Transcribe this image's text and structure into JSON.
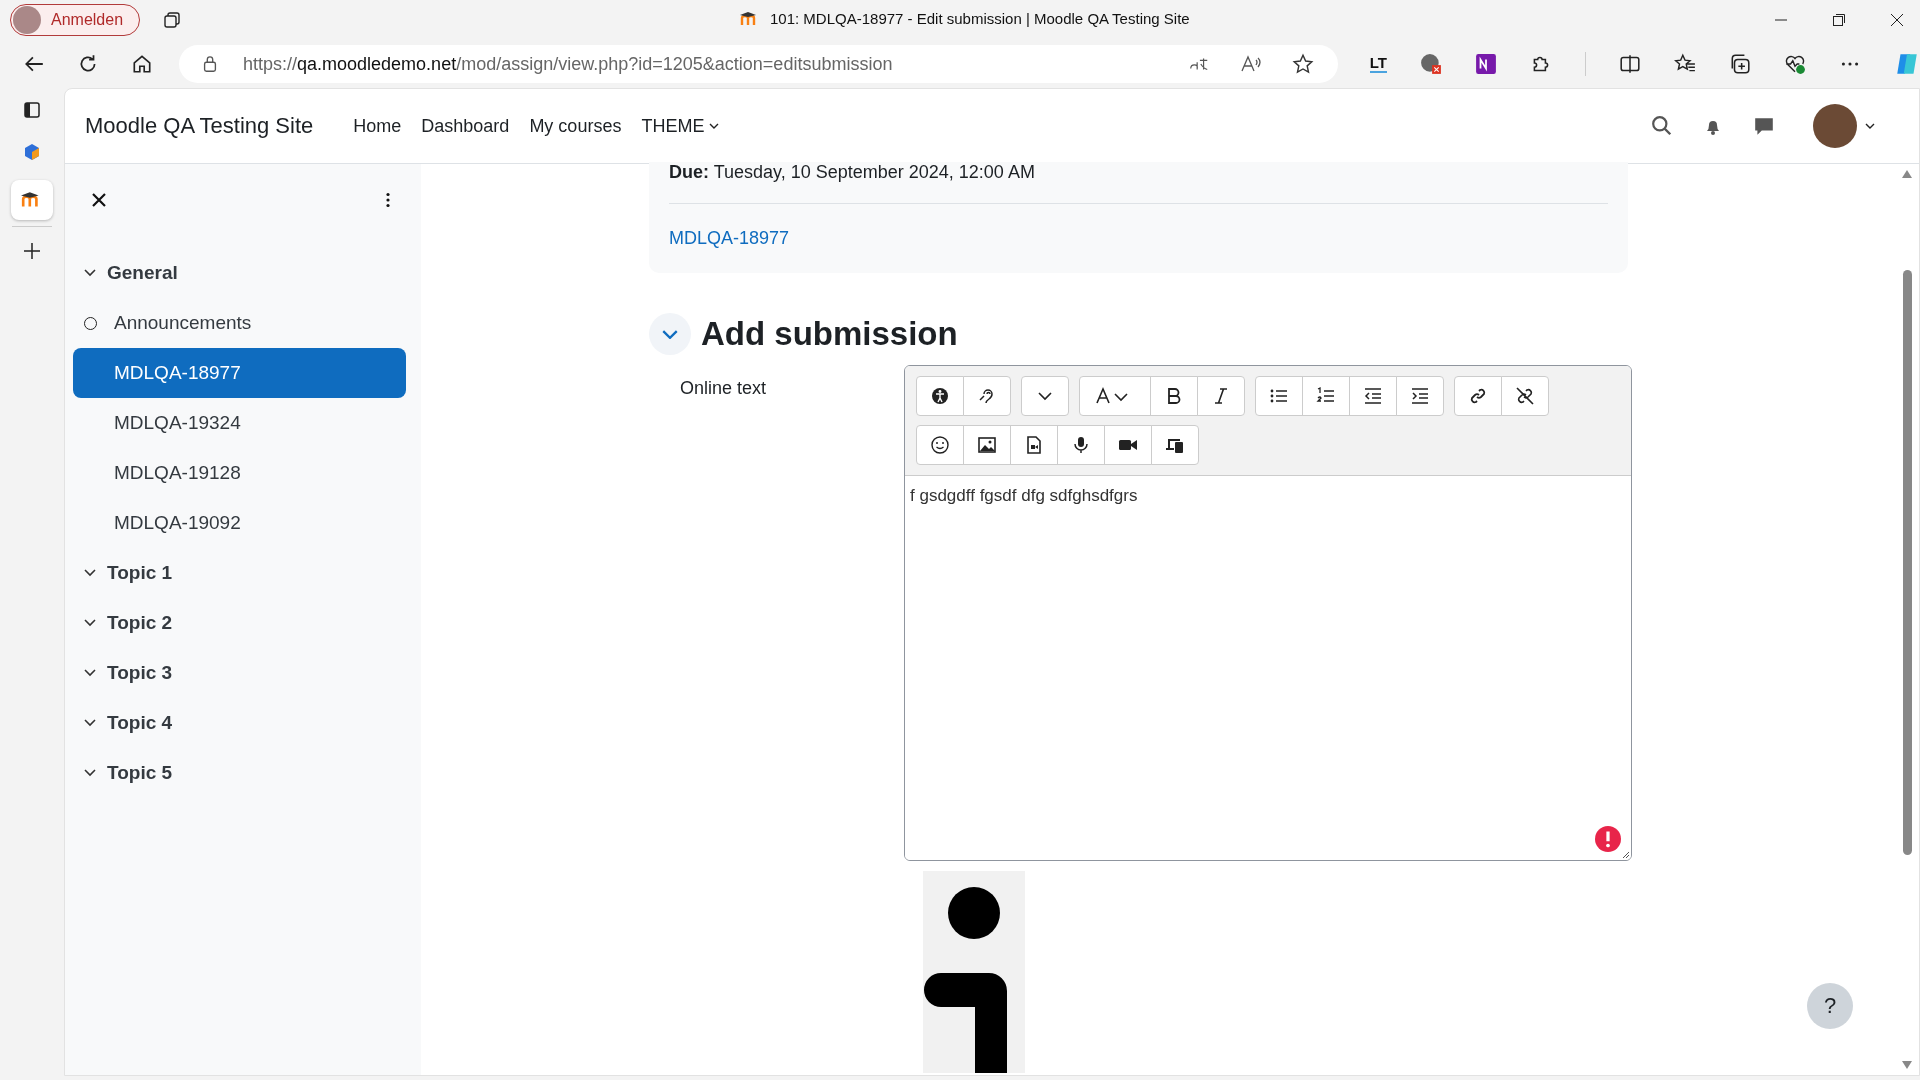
{
  "browser": {
    "profile_button": "Anmelden",
    "tab_title": "101: MDLQA-18977 - Edit submission | Moodle QA Testing Site",
    "url_scheme": "https://",
    "url_host": "qa.moodledemo.net",
    "url_path": "/mod/assign/view.php?id=1205&action=editsubmission",
    "extension_label": "LT"
  },
  "navbar": {
    "site_name": "Moodle QA Testing Site",
    "links": [
      {
        "label": "Home",
        "dropdown": false
      },
      {
        "label": "Dashboard",
        "dropdown": false
      },
      {
        "label": "My courses",
        "dropdown": false
      },
      {
        "label": "THEME",
        "dropdown": true
      }
    ]
  },
  "course_index": {
    "items": [
      {
        "kind": "section",
        "label": "General",
        "expanded": true,
        "selected": false,
        "children": [
          {
            "kind": "forum",
            "label": "Announcements",
            "selected": false
          },
          {
            "kind": "assign",
            "label": "MDLQA-18977",
            "selected": true
          },
          {
            "kind": "assign",
            "label": "MDLQA-19324",
            "selected": false
          },
          {
            "kind": "assign",
            "label": "MDLQA-19128",
            "selected": false
          },
          {
            "kind": "assign",
            "label": "MDLQA-19092",
            "selected": false
          }
        ]
      },
      {
        "kind": "section",
        "label": "Topic 1",
        "expanded": true,
        "selected": false
      },
      {
        "kind": "section",
        "label": "Topic 2",
        "expanded": true,
        "selected": false
      },
      {
        "kind": "section",
        "label": "Topic 3",
        "expanded": true,
        "selected": false
      },
      {
        "kind": "section",
        "label": "Topic 4",
        "expanded": true,
        "selected": false
      },
      {
        "kind": "section",
        "label": "Topic 5",
        "expanded": true,
        "selected": false
      }
    ]
  },
  "activity": {
    "due": "**Due:** Tuesday, 10 September 2024, 12:00 AM",
    "link": "MDLQA-18977"
  },
  "submission": {
    "heading": "Add submission",
    "expanded": true,
    "field_label": "Online text",
    "editor_text": "f gsdgdff fgsdf dfg sdfghsdfgrs",
    "has_error": true
  },
  "help_button": "?"
}
